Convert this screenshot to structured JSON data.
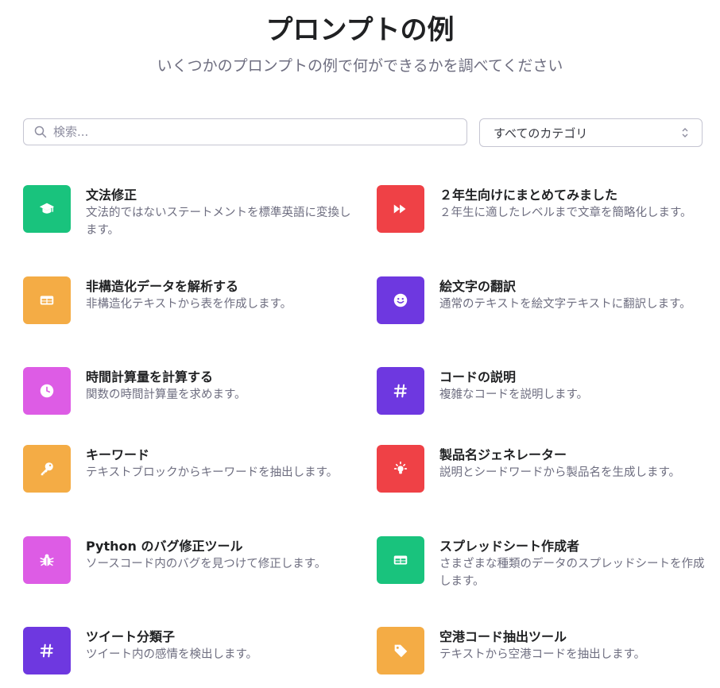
{
  "header": {
    "title": "プロンプトの例",
    "subtitle": "いくつかのプロンプトの例で何ができるかを調べてください"
  },
  "search": {
    "placeholder": "検索...",
    "value": ""
  },
  "category_select": {
    "selected": "すべてのカテゴリ"
  },
  "colors": {
    "green": "#19c37d",
    "red": "#ef4146",
    "orange": "#f4ac45",
    "purple": "#6e38e0",
    "magenta": "#dd5ce5"
  },
  "examples": [
    {
      "title": "文法修正",
      "description": "文法的ではないステートメントを標準英語に変換します。",
      "icon": "graduation-cap-icon",
      "color": "#19c37d"
    },
    {
      "title": "２年生向けにまとめてみました",
      "description": "２年生に適したレベルまで文章を簡略化します。",
      "icon": "fast-forward-icon",
      "color": "#ef4146"
    },
    {
      "title": "非構造化データを解析する",
      "description": "非構造化テキストから表を作成します。",
      "icon": "table-icon",
      "color": "#f4ac45"
    },
    {
      "title": "絵文字の翻訳",
      "description": "通常のテキストを絵文字テキストに翻訳します。",
      "icon": "smiley-icon",
      "color": "#6e38e0"
    },
    {
      "title": "時間計算量を計算する",
      "description": "関数の時間計算量を求めます。",
      "icon": "clock-icon",
      "color": "#dd5ce5"
    },
    {
      "title": "コードの説明",
      "description": "複雑なコードを説明します。",
      "icon": "hashtag-icon",
      "color": "#6e38e0"
    },
    {
      "title": "キーワード",
      "description": "テキストブロックからキーワードを抽出します。",
      "icon": "key-icon",
      "color": "#f4ac45"
    },
    {
      "title": "製品名ジェネレーター",
      "description": "説明とシードワードから製品名を生成します。",
      "icon": "lightbulb-icon",
      "color": "#ef4146"
    },
    {
      "title": "Python のバグ修正ツール",
      "description": "ソースコード内のバグを見つけて修正します。",
      "icon": "bug-icon",
      "color": "#dd5ce5"
    },
    {
      "title": "スプレッドシート作成者",
      "description": "さまざまな種類のデータのスプレッドシートを作成します。",
      "icon": "table-icon",
      "color": "#19c37d"
    },
    {
      "title": "ツイート分類子",
      "description": "ツイート内の感情を検出します。",
      "icon": "hashtag-icon",
      "color": "#6e38e0"
    },
    {
      "title": "空港コード抽出ツール",
      "description": "テキストから空港コードを抽出します。",
      "icon": "tag-icon",
      "color": "#f4ac45"
    }
  ]
}
